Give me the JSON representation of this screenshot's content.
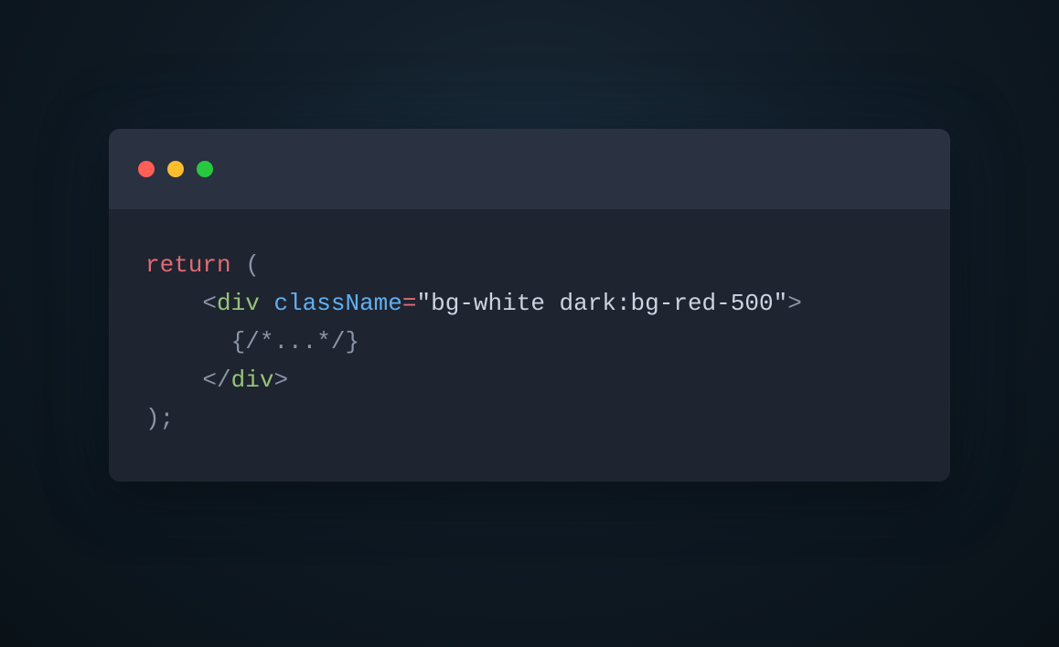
{
  "code": {
    "line1": {
      "keyword": "return",
      "space": " ",
      "paren": "("
    },
    "line2": {
      "indent": "    ",
      "lt": "<",
      "tag": "div",
      "space": " ",
      "attr": "className",
      "eq": "=",
      "q1": "\"",
      "value": "bg-white dark:bg-red-500",
      "q2": "\"",
      "gt": ">"
    },
    "line3": {
      "indent": "      ",
      "lbrace": "{",
      "comment": "/*...*/",
      "rbrace": "}"
    },
    "line4": {
      "indent": "    ",
      "lt": "<",
      "slash": "/",
      "tag": "div",
      "gt": ">"
    },
    "line5": {
      "paren": ")",
      "semi": ";"
    }
  }
}
